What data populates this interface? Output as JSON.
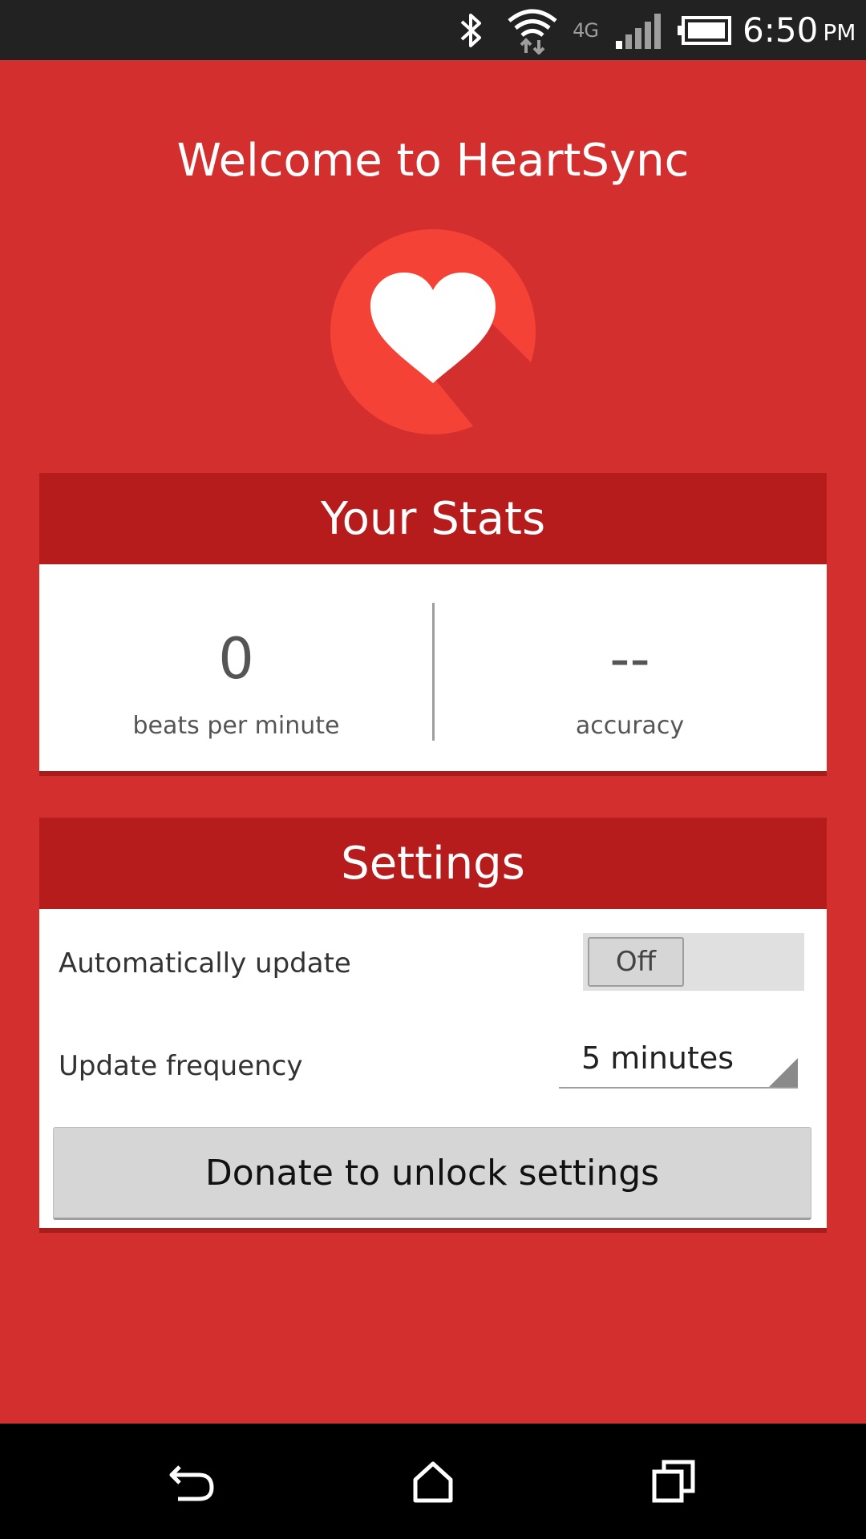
{
  "status_bar": {
    "network_type": "4G",
    "time": "6:50",
    "ampm": "PM",
    "icons": [
      "bluetooth-icon",
      "wifi-icon",
      "signal-icon",
      "battery-icon"
    ]
  },
  "header": {
    "title": "Welcome to HeartSync",
    "logo_icon": "heart-logo-icon"
  },
  "stats": {
    "title": "Your Stats",
    "bpm_value": "0",
    "bpm_label": "beats per minute",
    "accuracy_value": "--",
    "accuracy_label": "accuracy"
  },
  "settings": {
    "title": "Settings",
    "auto_update_label": "Automatically update",
    "auto_update_state": "Off",
    "frequency_label": "Update frequency",
    "frequency_value": "5 minutes",
    "donate_label": "Donate to unlock settings"
  },
  "nav_bar": {
    "icons": [
      "back-icon",
      "home-icon",
      "recent-apps-icon"
    ]
  },
  "colors": {
    "background": "#d32f2f",
    "card_header": "#b71c1c",
    "logo_circle": "#f44336",
    "status_bar": "#222222"
  }
}
